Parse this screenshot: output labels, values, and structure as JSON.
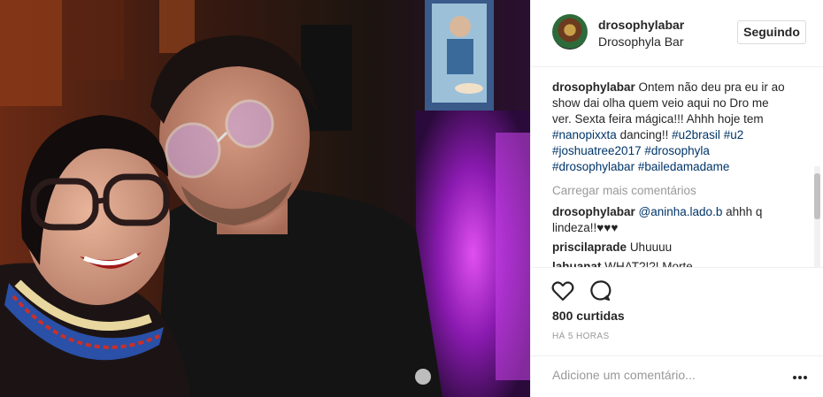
{
  "post": {
    "username": "drosophylabar",
    "location": "Drosophyla Bar",
    "follow_label": "Seguindo"
  },
  "caption": {
    "user": "drosophylabar",
    "text": "Ontem não deu pra eu ir ao show dai olha quem veio aqui no Dro me ver. Sexta feira mágica!!! Ahhh hoje tem",
    "tags": [
      "#nanopixxta",
      "dancing!!",
      "#u2brasil",
      "#u2",
      "#joshuatree2017",
      "#drosophyla",
      "#drosophylabar",
      "#bailedamadame"
    ]
  },
  "load_more_label": "Carregar mais comentários",
  "comments": [
    {
      "user": "drosophylabar",
      "mention": "@aninha.lado.b",
      "text": "ahhh q lindeza!!♥♥♥"
    },
    {
      "user": "priscilaprade",
      "text": "Uhuuuu"
    },
    {
      "user": "lahuanat",
      "text": "WHAT?!?! Morte"
    }
  ],
  "actions": {
    "like_icon": "heart-icon",
    "comment_icon": "comment-bubble-icon",
    "likes": "800 curtidas",
    "time": "HÁ 5 HORAS"
  },
  "add_comment": {
    "placeholder": "Adicione um comentário...",
    "more_icon": "more-options-icon"
  },
  "colors": {
    "hashtag": "#003569",
    "muted": "#999999",
    "text": "#262626",
    "border": "#efefef"
  }
}
